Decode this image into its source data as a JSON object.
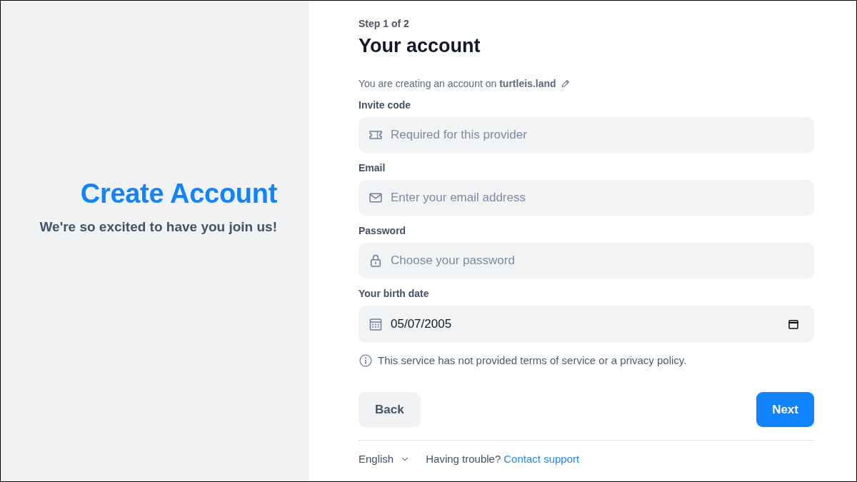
{
  "intro_panel": {
    "title": "Create Account",
    "subtitle": "We're so excited to have you join us!"
  },
  "step": "Step 1 of 2",
  "heading": "Your account",
  "provider_notice": "You are creating an account on **turtleis.land**",
  "fields": [
    {
      "kind": "invite",
      "label": "Invite code",
      "placeholder": "Required for this provider"
    },
    {
      "kind": "email",
      "label": "Email",
      "placeholder": "Enter your email address"
    },
    {
      "kind": "password",
      "label": "Password",
      "placeholder": "Choose your password"
    },
    {
      "kind": "date",
      "label": "Your birth date",
      "value": "05/07/2005"
    }
  ],
  "terms_notice": "This service has not provided terms of service or a privacy policy.",
  "buttons": [
    {
      "kind": "secondary",
      "label": "Back"
    },
    {
      "kind": "primary",
      "label": "Next"
    }
  ],
  "footer": {
    "language": "English",
    "help_text": "Having trouble?",
    "help_link": "Contact support"
  }
}
